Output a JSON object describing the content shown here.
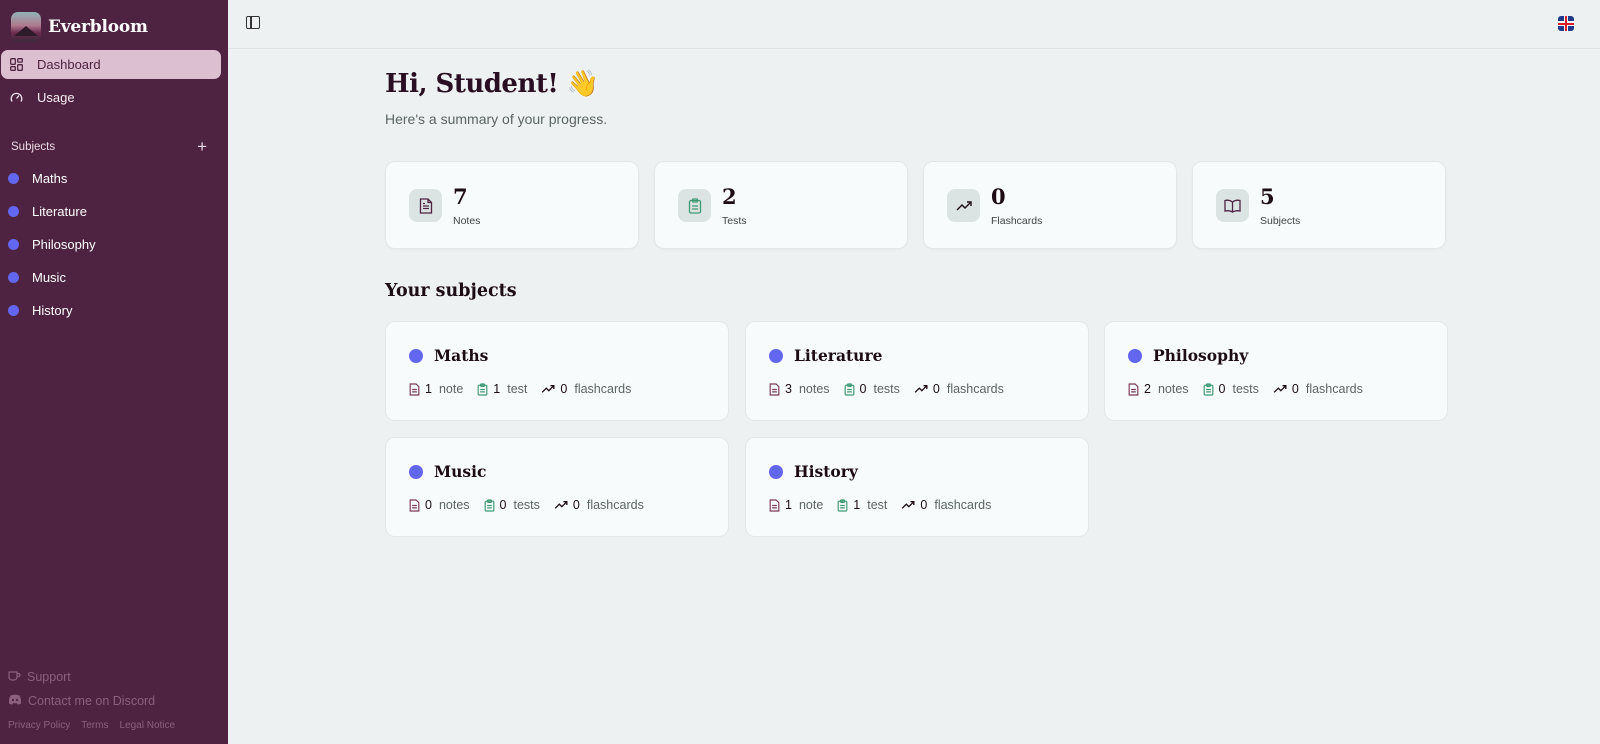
{
  "app": {
    "name": "Everbloom"
  },
  "sidebar": {
    "nav": [
      {
        "label": "Dashboard",
        "icon": "dashboard-grid-icon",
        "active": true
      },
      {
        "label": "Usage",
        "icon": "gauge-icon",
        "active": false
      }
    ],
    "subjects_header": "Subjects",
    "subjects": [
      {
        "label": "Maths"
      },
      {
        "label": "Literature"
      },
      {
        "label": "Philosophy"
      },
      {
        "label": "Music"
      },
      {
        "label": "History"
      }
    ],
    "footer": {
      "support": "Support",
      "discord": "Contact me on Discord",
      "privacy": "Privacy Policy",
      "terms": "Terms",
      "legal": "Legal Notice"
    }
  },
  "topbar": {
    "language_flag": "uk-flag-icon"
  },
  "main": {
    "greeting": "Hi, Student! 👋",
    "subtitle": "Here's a summary of your progress.",
    "stats": [
      {
        "value": "7",
        "label": "Notes",
        "icon": "document-icon"
      },
      {
        "value": "2",
        "label": "Tests",
        "icon": "clipboard-icon"
      },
      {
        "value": "0",
        "label": "Flashcards",
        "icon": "trending-up-icon"
      },
      {
        "value": "5",
        "label": "Subjects",
        "icon": "book-open-icon"
      }
    ],
    "subjects_title": "Your subjects",
    "subject_cards": [
      {
        "name": "Maths",
        "notes": "1",
        "notes_label": "note",
        "tests": "1",
        "tests_label": "test",
        "flashcards": "0",
        "flashcards_label": "flashcards"
      },
      {
        "name": "Literature",
        "notes": "3",
        "notes_label": "notes",
        "tests": "0",
        "tests_label": "tests",
        "flashcards": "0",
        "flashcards_label": "flashcards"
      },
      {
        "name": "Philosophy",
        "notes": "2",
        "notes_label": "notes",
        "tests": "0",
        "tests_label": "tests",
        "flashcards": "0",
        "flashcards_label": "flashcards"
      },
      {
        "name": "Music",
        "notes": "0",
        "notes_label": "notes",
        "tests": "0",
        "tests_label": "tests",
        "flashcards": "0",
        "flashcards_label": "flashcards"
      },
      {
        "name": "History",
        "notes": "1",
        "notes_label": "note",
        "tests": "1",
        "tests_label": "test",
        "flashcards": "0",
        "flashcards_label": "flashcards"
      }
    ]
  },
  "colors": {
    "sidebar_bg": "#4e2342",
    "active_nav_bg": "#dcc0d2",
    "subject_dot": "#6366f1",
    "page_bg": "#eef1f1",
    "note_icon": "#7a3a5a",
    "test_icon": "#3f9a74"
  }
}
